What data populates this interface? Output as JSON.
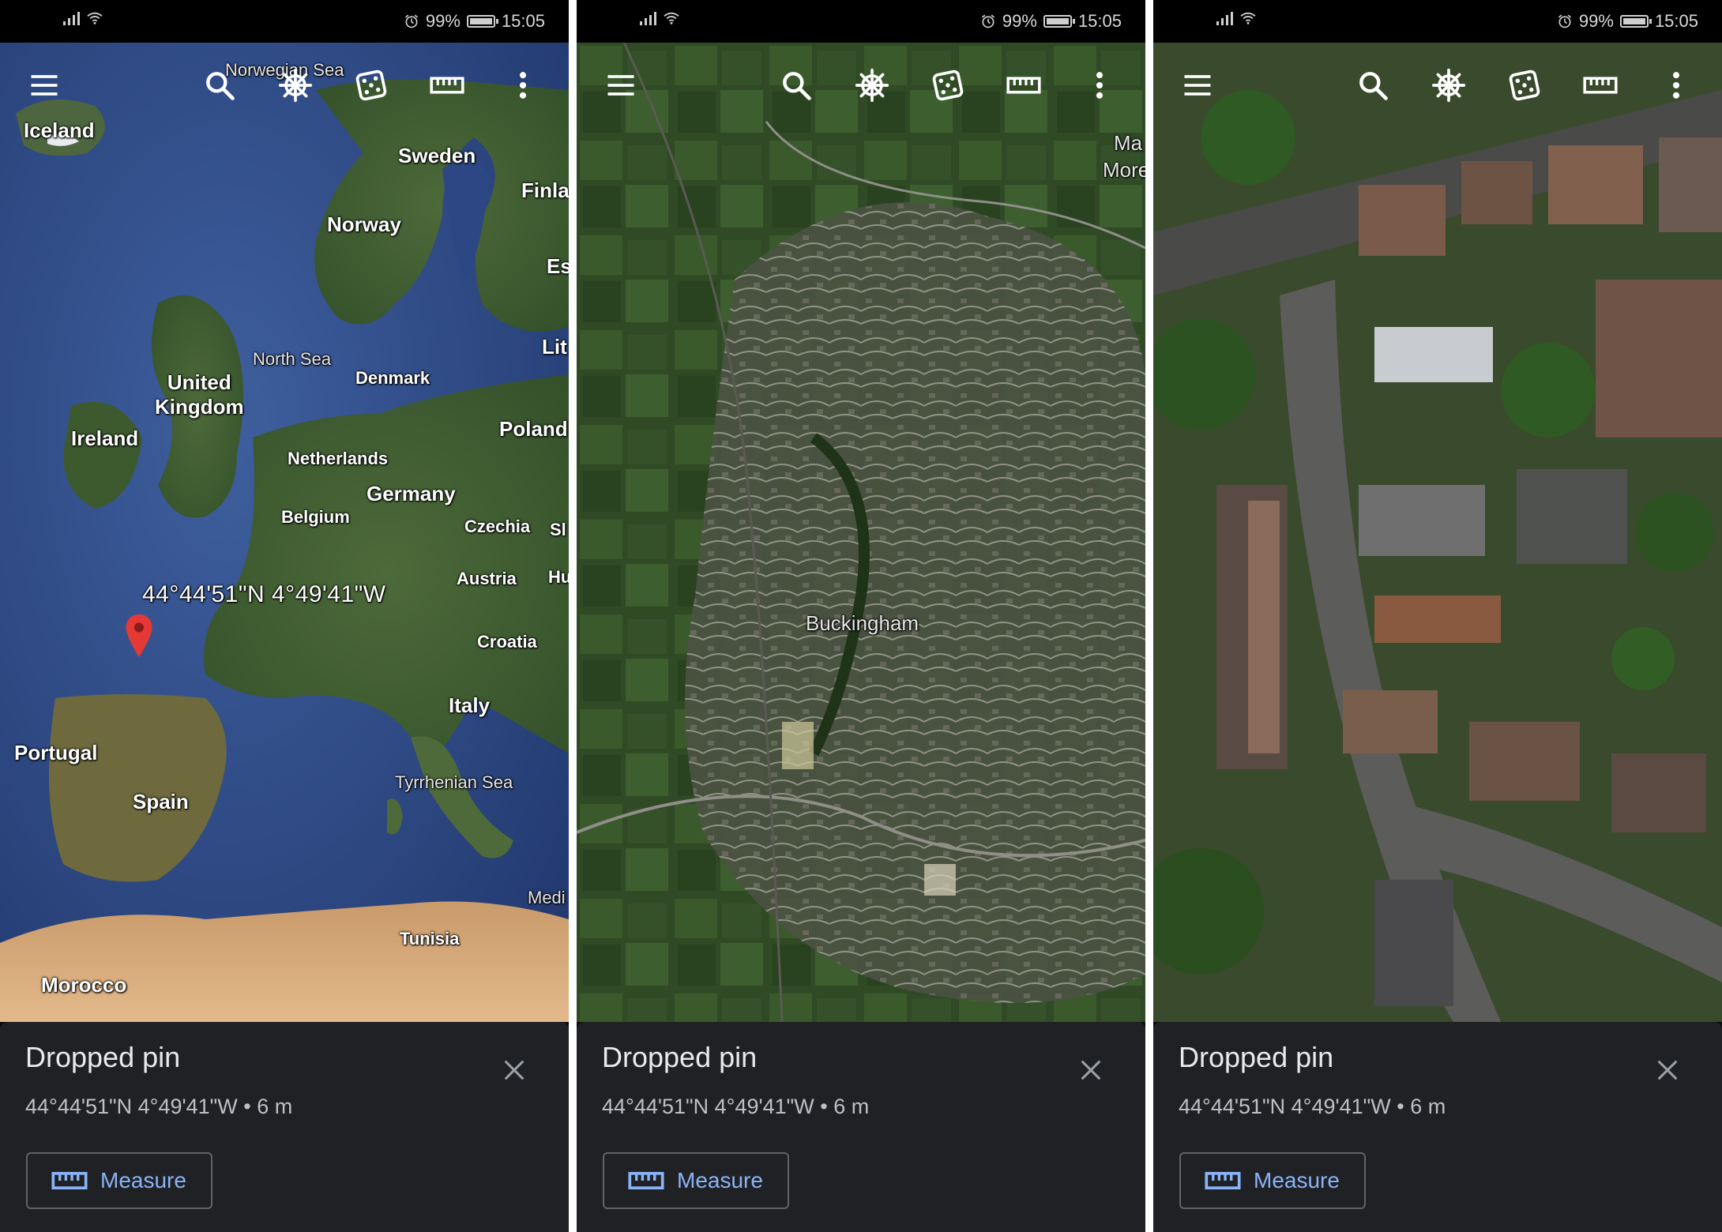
{
  "status_bar": {
    "battery": "99%",
    "battery_level": 0.99,
    "time": "15:05"
  },
  "toolbar": {
    "icons": [
      "menu-icon",
      "search-icon",
      "voyager-icon",
      "feeling-lucky-dice-icon",
      "measure-ruler-icon",
      "more-vert-icon"
    ]
  },
  "panels": [
    {
      "labels": {
        "iceland": "Iceland",
        "norwegian_sea": "Norwegian Sea",
        "sweden": "Sweden",
        "finland": "Finla",
        "norway": "Norway",
        "estonia": "Es",
        "lithuania": "Lit",
        "north_sea": "North Sea",
        "united_kingdom": "United\nKingdom",
        "denmark": "Denmark",
        "ireland": "Ireland",
        "poland": "Poland",
        "netherlands": "Netherlands",
        "germany": "Germany",
        "belgium": "Belgium",
        "czechia": "Czechia",
        "slovakia": "Sl",
        "austria": "Austria",
        "hungary": "Hu",
        "croatia": "Croatia",
        "italy": "Italy",
        "portugal": "Portugal",
        "spain": "Spain",
        "tyrrhenian_sea": "Tyrrhenian Sea",
        "mediterranean": "Medi",
        "tunisia": "Tunisia",
        "morocco": "Morocco"
      },
      "pin_coords": "44°44'51\"N 4°49'41\"W"
    },
    {
      "labels": {
        "buckingham": "Buckingham",
        "maids_moreton_1": "Ma",
        "maids_moreton_2": "More"
      }
    },
    {
      "labels": {}
    }
  ],
  "sheet": {
    "title": "Dropped pin",
    "subtitle": "44°44'51\"N 4°49'41\"W • 6 m",
    "measure_label": "Measure"
  },
  "colors": {
    "accent": "#8ab4f8",
    "sheet_bg": "#202124",
    "pin": "#e53935"
  }
}
